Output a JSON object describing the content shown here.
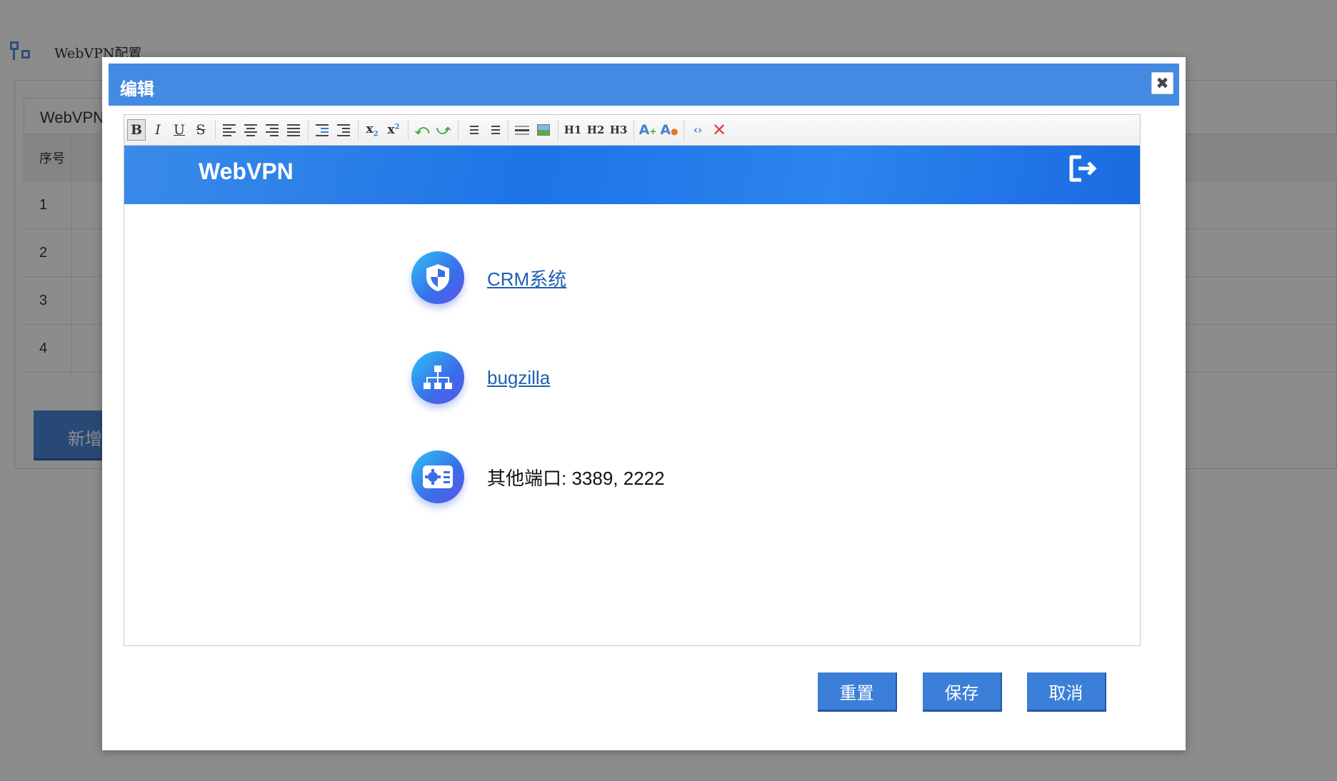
{
  "background": {
    "breadcrumb": "WebVPN配置",
    "tab_label": "WebVPN",
    "table_header": "序号",
    "rows": [
      "1",
      "2",
      "3",
      "4"
    ],
    "add_button": "新增"
  },
  "modal": {
    "title": "编辑",
    "close_symbol": "✖",
    "toolbar": {
      "buttons": [
        "bold",
        "italic",
        "underline",
        "strikethrough",
        "align-left",
        "align-center",
        "align-right",
        "align-justify",
        "indent",
        "outdent",
        "subscript",
        "superscript",
        "undo",
        "redo",
        "ordered-list",
        "unordered-list",
        "horizontal-rule",
        "insert-image",
        "heading-1",
        "heading-2",
        "heading-3",
        "font-color",
        "remove-format",
        "source-code",
        "clear"
      ],
      "bold": "B",
      "italic": "I",
      "underline": "U",
      "strike": "S",
      "h1": "H1",
      "h2": "H2",
      "h3": "H3"
    },
    "content": {
      "banner_title": "WebVPN",
      "items": [
        {
          "label": "CRM系统",
          "icon": "shield-icon",
          "link": true
        },
        {
          "label": "bugzilla",
          "icon": "sitemap-icon",
          "link": true
        },
        {
          "label": "其他端口: 3389, 2222",
          "icon": "id-card-icon",
          "link": false
        }
      ]
    },
    "buttons": {
      "reset": "重置",
      "save": "保存",
      "cancel": "取消"
    }
  },
  "colors": {
    "header_blue": "#4489e2",
    "button_blue": "#3b7fd8",
    "banner_blue": "#1d74e6",
    "link": "#1f5fb0"
  }
}
